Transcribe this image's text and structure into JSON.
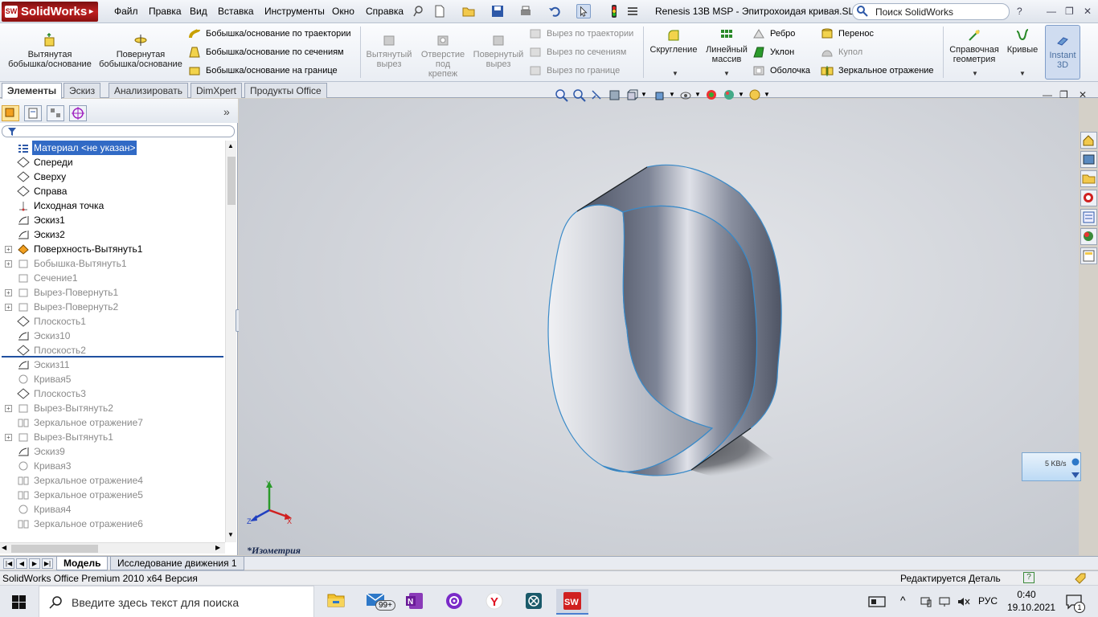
{
  "app": {
    "logo": "SolidWorks",
    "logo_badge": "SW",
    "doc_title": "Renesis 13B MSP - Эпитрохоидая кривая.SLD...",
    "search_placeholder": "Поиск SolidWorks",
    "help_mark": "?"
  },
  "menu": [
    "Файл",
    "Правка",
    "Вид",
    "Вставка",
    "Инструменты",
    "Окно",
    "Справка"
  ],
  "ribbon": {
    "extruded_boss": "Вытянутая\nбобышка/основание",
    "revolved_boss": "Повернутая\nбобышка/основание",
    "swept_boss": "Бобышка/основание по траектории",
    "lofted_boss": "Бобышка/основание по сечениям",
    "boundary_boss": "Бобышка/основание на границе",
    "extruded_cut": "Вытянутый\nвырез",
    "hole_wizard": "Отверстие\nпод\nкрепеж",
    "revolved_cut": "Повернутый\nвырез",
    "swept_cut": "Вырез по траектории",
    "lofted_cut": "Вырез по сечениям",
    "boundary_cut": "Вырез по границе",
    "fillet": "Скругление",
    "linear_pattern": "Линейный\nмассив",
    "rib": "Ребро",
    "draft": "Уклон",
    "shell": "Оболочка",
    "wrap": "Перенос",
    "dome": "Купол",
    "mirror": "Зеркальное отражение",
    "ref_geometry": "Справочная\nгеометрия",
    "curves": "Кривые",
    "instant3d": "Instant\n3D"
  },
  "tabs": [
    "Элементы",
    "Эскиз",
    "Анализировать",
    "DimXpert",
    "Продукты Office"
  ],
  "panel": {
    "expand": "»"
  },
  "tree": [
    {
      "label": "Материал <не указан>",
      "icon": "material-icon",
      "state": "selected"
    },
    {
      "label": "Спереди",
      "icon": "plane-icon",
      "state": "normal"
    },
    {
      "label": "Сверху",
      "icon": "plane-icon",
      "state": "normal"
    },
    {
      "label": "Справа",
      "icon": "plane-icon",
      "state": "normal"
    },
    {
      "label": "Исходная точка",
      "icon": "origin-icon",
      "state": "normal"
    },
    {
      "label": "Эскиз1",
      "icon": "sketch-icon",
      "state": "normal"
    },
    {
      "label": "Эскиз2",
      "icon": "sketch-icon",
      "state": "normal"
    },
    {
      "label": "Поверхность-Вытянуть1",
      "icon": "surface-icon",
      "state": "normal",
      "expand": true
    },
    {
      "label": "Бобышка-Вытянуть1",
      "icon": "feature-icon",
      "state": "suppressed",
      "expand": true
    },
    {
      "label": "Сечение1",
      "icon": "feature-icon",
      "state": "suppressed"
    },
    {
      "label": "Вырез-Повернуть1",
      "icon": "feature-icon",
      "state": "suppressed",
      "expand": true
    },
    {
      "label": "Вырез-Повернуть2",
      "icon": "feature-icon",
      "state": "suppressed",
      "expand": true
    },
    {
      "label": "Плоскость1",
      "icon": "plane-icon",
      "state": "suppressed"
    },
    {
      "label": "Эскиз10",
      "icon": "sketch-icon",
      "state": "suppressed"
    },
    {
      "label": "Плоскость2",
      "icon": "plane-icon",
      "state": "suppressed"
    },
    {
      "label": "Эскиз11",
      "icon": "sketch-icon",
      "state": "suppressed"
    },
    {
      "label": "Кривая5",
      "icon": "curve-icon",
      "state": "suppressed"
    },
    {
      "label": "Плоскость3",
      "icon": "plane-icon",
      "state": "suppressed"
    },
    {
      "label": "Вырез-Вытянуть2",
      "icon": "feature-icon",
      "state": "suppressed",
      "expand": true
    },
    {
      "label": "Зеркальное отражение7",
      "icon": "mirror-icon",
      "state": "suppressed"
    },
    {
      "label": "Вырез-Вытянуть1",
      "icon": "feature-icon",
      "state": "suppressed",
      "expand": true
    },
    {
      "label": "Эскиз9",
      "icon": "sketch-icon",
      "state": "suppressed"
    },
    {
      "label": "Кривая3",
      "icon": "curve-icon",
      "state": "suppressed"
    },
    {
      "label": "Зеркальное отражение4",
      "icon": "mirror-icon",
      "state": "suppressed"
    },
    {
      "label": "Зеркальное отражение5",
      "icon": "mirror-icon",
      "state": "suppressed"
    },
    {
      "label": "Кривая4",
      "icon": "curve-icon",
      "state": "suppressed"
    },
    {
      "label": "Зеркальное отражение6",
      "icon": "mirror-icon",
      "state": "suppressed"
    }
  ],
  "viewport": {
    "view_label": "*Изометрия",
    "triad": {
      "x": "X",
      "y": "Y",
      "z": "Z"
    }
  },
  "net_widget": {
    "speed": "5 KB/s"
  },
  "model_tabs": [
    "Модель",
    "Исследование движения 1"
  ],
  "status": {
    "left": "SolidWorks Office Premium 2010 x64 Версия",
    "right": "Редактируется Деталь",
    "help": "?"
  },
  "taskbar": {
    "search_placeholder": "Введите здесь текст для поиска",
    "mail_badge": "99+",
    "lang": "РУС",
    "time": "0:40",
    "date": "19.10.2021",
    "notif_count": "1"
  },
  "colors": {
    "accent": "#316ac5",
    "sw_red": "#c02020",
    "model_edge": "#3a8ac8"
  }
}
